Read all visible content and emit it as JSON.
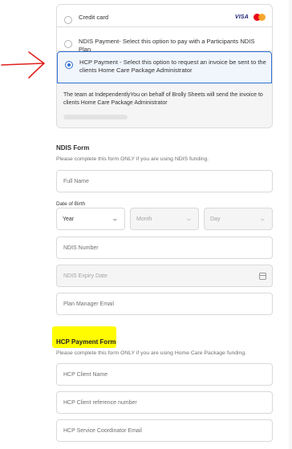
{
  "payment": {
    "options": [
      {
        "label": "Credit card",
        "selected": false
      },
      {
        "label": "NDIS Payment- Select this option to pay with a Participants NDIS Plan",
        "selected": false
      },
      {
        "label": "HCP Payment - Select this option to request an invoice be sent to the clients Home Care Package Administrator",
        "selected": true
      }
    ],
    "card_logos": {
      "visa": "VISA"
    },
    "hcp_info": "The team at IndependentlyYou on behalf of Brolly Sheets will send the invoice to clients Home Care Package Administrator"
  },
  "ndis_form": {
    "title": "NDIS Form",
    "subtitle": "Please complete this form ONLY if you are using NDIS funding.",
    "full_name_placeholder": "Full Name",
    "dob": {
      "label": "Date of Birth",
      "year": "Year",
      "month": "Month",
      "day": "Day"
    },
    "ndis_number_placeholder": "NDIS Number",
    "ndis_expiry_placeholder": "NDIS Expiry Date",
    "plan_manager_email_placeholder": "Plan Manager Email"
  },
  "hcp_form": {
    "title": "HCP Payment Form",
    "subtitle": "Please complete this form ONLY if you are using Home Care Package funding.",
    "client_name_placeholder": "HCP Client Name",
    "client_reference_placeholder": "HCP Client reference number",
    "coordinator_email_placeholder": "HCP Service Coordinator Email"
  },
  "colors": {
    "accent": "#2f6fd6",
    "annotation_arrow": "#e0201b",
    "highlight": "#fffb00"
  },
  "icons": [
    "red-arrow-annotation-icon",
    "visa-logo-icon",
    "mastercard-logo-icon",
    "calendar-icon",
    "chevron-down-icon"
  ]
}
